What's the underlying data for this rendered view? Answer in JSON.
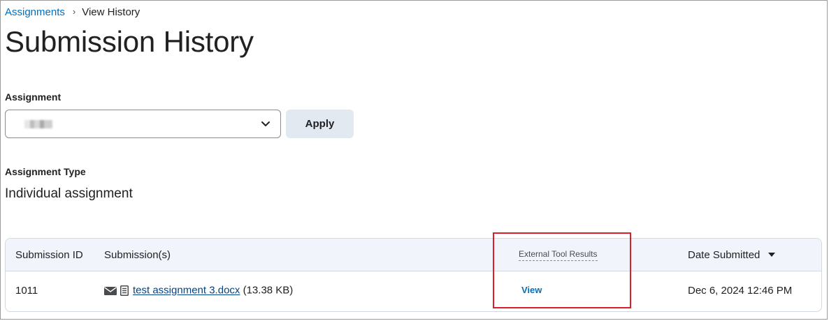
{
  "breadcrumb": {
    "parent": "Assignments",
    "separator": "›",
    "current": "View History"
  },
  "page": {
    "title": "Submission History"
  },
  "assignment_filter": {
    "label": "Assignment",
    "selected_value": "",
    "apply_label": "Apply"
  },
  "assignment_type": {
    "label": "Assignment Type",
    "value": "Individual assignment"
  },
  "table": {
    "columns": {
      "submission_id": "Submission ID",
      "submissions": "Submission(s)",
      "external_tool_results": "External Tool Results",
      "date_submitted": "Date Submitted"
    },
    "rows": [
      {
        "submission_id": "1011",
        "file_name": "test assignment 3.docx",
        "file_size": "(13.38 KB)",
        "external_tool_action": "View",
        "date_submitted": "Dec 6, 2024 12:46 PM"
      }
    ],
    "sort": {
      "column": "date_submitted",
      "direction": "descending"
    }
  },
  "icons": [
    "chevron-right-icon",
    "chevron-down-icon",
    "envelope-icon",
    "document-icon",
    "sort-descending-icon"
  ],
  "colors": {
    "link": "#006fbf",
    "header_bg": "#f1f5fb",
    "apply_bg": "#e3e9f1",
    "highlight": "#d9202a"
  }
}
